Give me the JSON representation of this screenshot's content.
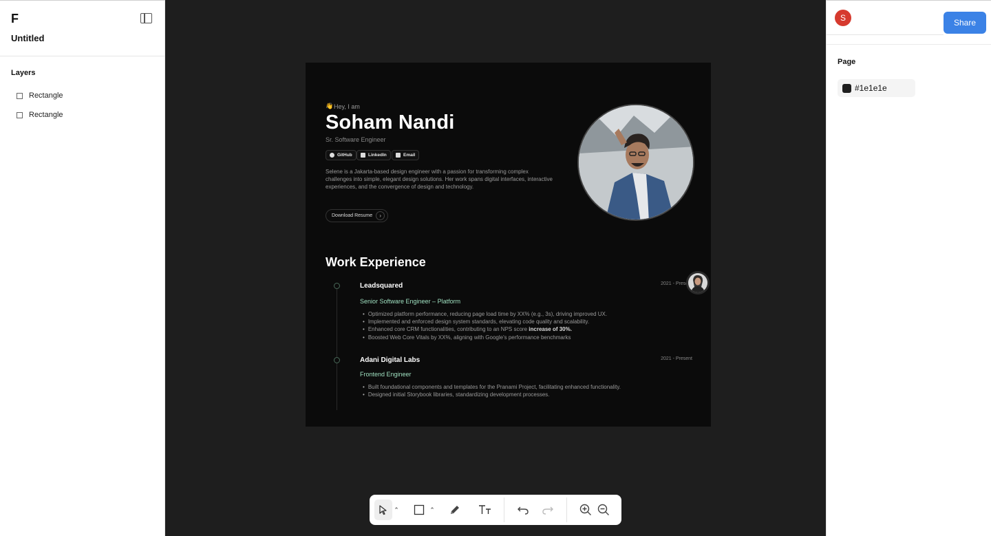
{
  "app": {
    "logo": "F",
    "file_name": "Untitled"
  },
  "layers": {
    "title": "Layers",
    "items": [
      {
        "label": "Rectangle"
      },
      {
        "label": "Rectangle"
      }
    ]
  },
  "right_panel": {
    "user_initial": "S",
    "share_label": "Share",
    "page_label": "Page",
    "page_color": "#1e1e1e",
    "page_color_text": "#1e1e1e"
  },
  "artboard": {
    "greeting_emoji": "👋",
    "greeting": "Hey, I am",
    "name": "Soham Nandi",
    "role": "Sr. Software Engineer",
    "links": [
      {
        "label": "GitHub"
      },
      {
        "label": "LinkedIn"
      },
      {
        "label": "Email"
      }
    ],
    "bio": "Selene is a Jakarta-based design engineer with a passion for transforming complex challenges into simple, elegant design solutions. Her work spans digital interfaces, interactive experiences, and the convergence of design and technology.",
    "download_label": "Download Resume",
    "work_title": "Work Experience",
    "jobs": [
      {
        "company": "Leadsquared",
        "period": "2021 - Present",
        "title": "Senior Software Engineer – Platform",
        "bullets": [
          "Optimized platform performance, reducing page load time by XX% (e.g., 3s), driving improved UX.",
          "Implemented and enforced design system standards, elevating code quality and scalability.",
          "Boosted Web Core Vitals by XX%, aligning with Google's performance benchmarks"
        ],
        "bullet_bold_prefix": "Enhanced core CRM functionalities, contributing to an NPS score ",
        "bullet_bold": "increase of 30%."
      },
      {
        "company": "Adani Digital Labs",
        "period": "2021 - Present",
        "title": "Frontend Engineer",
        "bullets": [
          "Built foundational components and templates for the Pranami Project, facilitating enhanced functionality.",
          "Designed initial Storybook libraries, standardizing development processes."
        ]
      }
    ]
  },
  "toolbar": {
    "tools": [
      "select-tool",
      "rectangle-tool",
      "pen-tool",
      "text-tool",
      "undo",
      "redo",
      "zoom-in",
      "zoom-out"
    ]
  }
}
